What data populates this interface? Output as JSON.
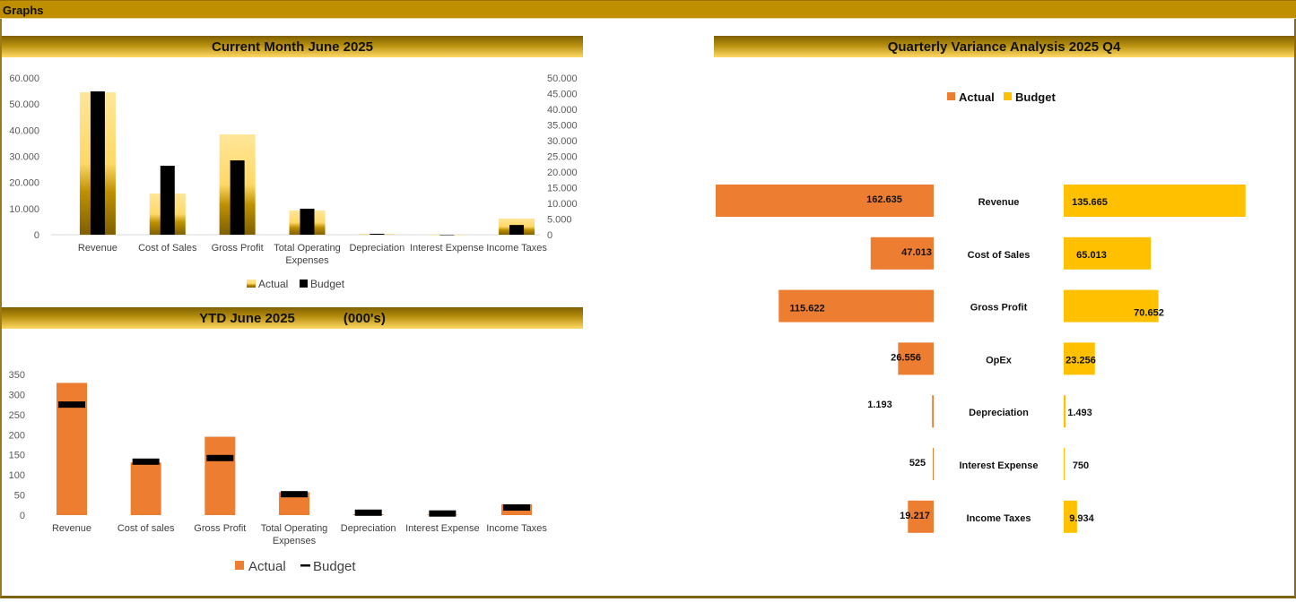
{
  "page": {
    "title": "Graphs"
  },
  "chart_data": [
    {
      "id": "current-month",
      "type": "bar",
      "title": "Current Month  June 2025",
      "categories": [
        "Revenue",
        "Cost of Sales",
        "Gross Profit",
        "Total Operating Expenses",
        "Depreciation",
        "Interest Expense",
        "Income Taxes"
      ],
      "category_lines": [
        [
          "Revenue"
        ],
        [
          "Cost of Sales"
        ],
        [
          "Gross Profit"
        ],
        [
          "Total Operating",
          "Expenses"
        ],
        [
          "Depreciation"
        ],
        [
          "Interest Expense"
        ],
        [
          "Income Taxes"
        ]
      ],
      "series": [
        {
          "name": "Actual",
          "axis": "left",
          "values": [
            54500,
            15800,
            38400,
            9300,
            200,
            0,
            6200
          ]
        },
        {
          "name": "Budget",
          "axis": "right",
          "values": [
            45700,
            22000,
            23700,
            8300,
            300,
            0,
            3100
          ]
        }
      ],
      "y_left": {
        "min": 0,
        "max": 60000,
        "ticks": [
          "0",
          "10.000",
          "20.000",
          "30.000",
          "40.000",
          "50.000",
          "60.000"
        ]
      },
      "y_right": {
        "min": 0,
        "max": 50000,
        "ticks": [
          "0",
          "5.000",
          "10.000",
          "15.000",
          "20.000",
          "25.000",
          "30.000",
          "35.000",
          "40.000",
          "45.000",
          "50.000"
        ]
      },
      "legend": [
        "Actual",
        "Budget"
      ],
      "legend_position": "bottom",
      "grid": false
    },
    {
      "id": "ytd",
      "type": "bar",
      "title": "YTD  June 2025",
      "subtitle": "(000's)",
      "categories": [
        "Revenue",
        "Cost of sales",
        "Gross Profit",
        "Total Operating Expenses",
        "Depreciation",
        "Interest Expense",
        "Income Taxes"
      ],
      "category_lines": [
        [
          "Revenue"
        ],
        [
          "Cost of sales"
        ],
        [
          "Gross Profit"
        ],
        [
          "Total Operating",
          "Expenses"
        ],
        [
          "Depreciation"
        ],
        [
          "Interest Expense"
        ],
        [
          "Income Taxes"
        ]
      ],
      "series": [
        {
          "name": "Actual",
          "style": "bar",
          "values": [
            329,
            131,
            195,
            57,
            2,
            1,
            27
          ]
        },
        {
          "name": "Budget",
          "style": "marker",
          "values": [
            275,
            133,
            142,
            52,
            6,
            4,
            19
          ]
        }
      ],
      "y": {
        "min": 0,
        "max": 350,
        "ticks": [
          "0",
          "50",
          "100",
          "150",
          "200",
          "250",
          "300",
          "350"
        ]
      },
      "legend": [
        "Actual",
        "Budget"
      ],
      "legend_position": "bottom",
      "grid": false
    },
    {
      "id": "quarterly",
      "type": "bar",
      "orientation": "horizontal-butterfly",
      "title": "Quarterly Variance Analysis  2025 Q4",
      "categories": [
        "Revenue",
        "Cost of Sales",
        "Gross Profit",
        "OpEx",
        "Depreciation",
        "Interest Expense",
        "Income Taxes"
      ],
      "series": [
        {
          "name": "Actual",
          "values": [
            162635,
            47013,
            115622,
            26556,
            1193,
            525,
            19217
          ],
          "labels": [
            "162.635",
            "47.013",
            "115.622",
            "26.556",
            "1.193",
            "525",
            "19.217"
          ]
        },
        {
          "name": "Budget",
          "values": [
            135665,
            65013,
            70652,
            23256,
            1493,
            750,
            9934
          ],
          "labels": [
            "135.665",
            "65.013",
            "70.652",
            "23.256",
            "1.493",
            "750",
            "9.934"
          ]
        }
      ],
      "legend": [
        "Actual",
        "Budget"
      ],
      "legend_position": "top",
      "grid": false
    }
  ],
  "colors": {
    "header": "#bf8f00",
    "gold_dark": "#7f6000",
    "gold_light": "#ffe699",
    "actual_orange": "#ed7d31",
    "budget_yellow": "#ffc000",
    "budget_black": "#000000",
    "axis_text": "#595959"
  }
}
